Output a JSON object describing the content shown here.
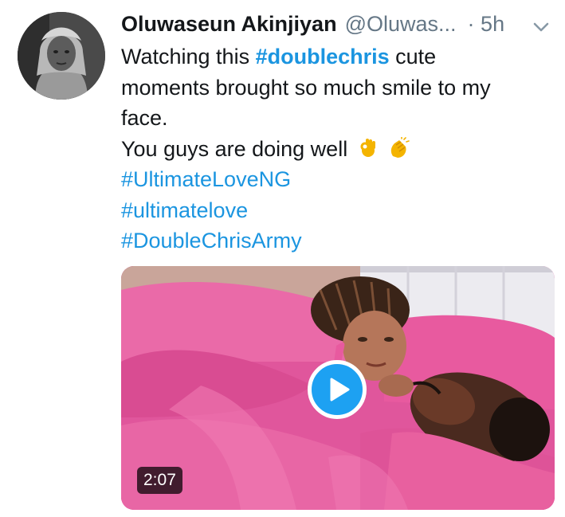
{
  "tweet": {
    "display_name": "Oluwaseun Akinjiyan",
    "handle": "@Oluwas...",
    "separator": "·",
    "time": "5h",
    "body": {
      "line1_prefix": "Watching this ",
      "line1_hashtag": "#doublechris",
      "line1_suffix": " cute",
      "line2": "moments brought so much smile to my",
      "line3": "face.",
      "line4": "You guys are doing well",
      "hashtags": [
        "#UltimateLoveNG",
        "#ultimatelove",
        "#DoubleChrisArmy"
      ]
    },
    "emojis": [
      "ok-hand-icon",
      "clapping-hands-icon"
    ],
    "media": {
      "type": "video",
      "duration": "2:07"
    }
  },
  "colors": {
    "hashtag": "#1b95e0",
    "text": "#14171a",
    "secondary": "#657786",
    "play_button": "#1da1f2",
    "sheet_pink": "#e0569c"
  }
}
